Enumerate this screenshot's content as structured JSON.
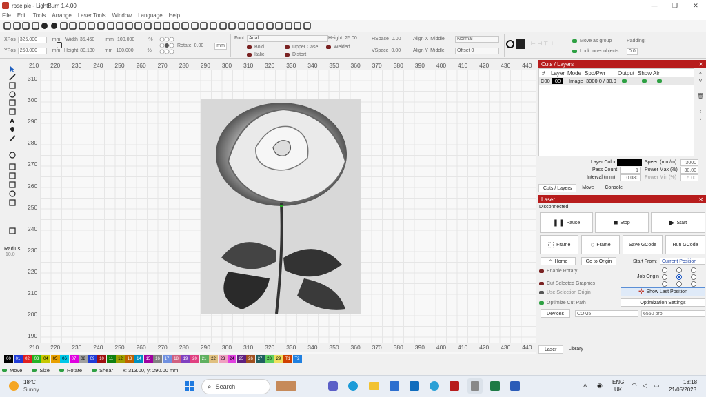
{
  "window": {
    "title": "rose pic - LightBurn 1.4.00",
    "minimize": "—",
    "restore": "❐",
    "close": "✕"
  },
  "menu": [
    "File",
    "Edit",
    "Tools",
    "Arrange",
    "Laser Tools",
    "Window",
    "Language",
    "Help"
  ],
  "toolbar_icons": [
    "new-icon",
    "open-icon",
    "save-icon",
    "save-as-icon",
    "import-icon",
    "undo-icon",
    "redo-icon",
    "copy-icon",
    "cut-icon",
    "paste-icon",
    "delete-icon",
    "move-icon",
    "zoom-in-icon",
    "zoom-out-icon",
    "zoom-fit-icon",
    "zoom-page-icon",
    "frame-icon",
    "camera-icon",
    "monitor-icon",
    "settings-icon",
    "tools-icon",
    "user-icon",
    "user-2-icon",
    "variable-text-icon",
    "align-icon",
    "group-icon",
    "ungroup-icon",
    "circle-icon",
    "grid-icon",
    "distribute-icon",
    "weld-icon",
    "center-icon",
    "cross-icon"
  ],
  "position": {
    "xpos_label": "XPos",
    "xpos": "325.000",
    "ypos_label": "YPos",
    "ypos": "250.000",
    "unit": "mm",
    "width_label": "Width",
    "width": "35.460",
    "height_label": "Height",
    "height": "80.130",
    "scale_x": "100.000",
    "scale_y": "100.000",
    "pct": "%",
    "rotate_label": "Rotate",
    "rotate": "0.00",
    "rotate_unit": "mm"
  },
  "text_props": {
    "font_label": "Font",
    "font": "Arial",
    "height_label": "Height",
    "height": "25.00",
    "hspace_label": "HSpace",
    "hspace": "0.00",
    "vspace_label": "VSpace",
    "vspace": "0.00",
    "bold": "Bold",
    "italic": "Italic",
    "upper": "Upper Case",
    "distort": "Distort",
    "welded": "Welded",
    "alignx_label": "Align X",
    "alignx": "Middle",
    "aligny_label": "Align Y",
    "aligny": "Middle",
    "style": "Normal",
    "offset": "Offset 0"
  },
  "group_opts": {
    "move_group": "Move as group",
    "lock_inner": "Lock inner objects",
    "padding_label": "Padding:",
    "padding": "0.0"
  },
  "left_tools": [
    "select-icon",
    "edit-nodes-icon",
    "rectangle-icon",
    "ellipse-icon",
    "polygon-icon",
    "polyline-icon",
    "text-icon",
    "position-icon",
    "measure-icon",
    "offset-icon",
    "boolean-icon",
    "weld-icon",
    "grid-array-icon",
    "circular-array-icon",
    "rotate-icon",
    "corner-icon"
  ],
  "radius": {
    "label": "Radius:",
    "value": "10.0"
  },
  "ruler_x": [
    "210",
    "220",
    "230",
    "240",
    "250",
    "260",
    "270",
    "280",
    "290",
    "300",
    "310",
    "320",
    "330",
    "340",
    "350",
    "360",
    "370",
    "380",
    "390",
    "400",
    "410",
    "420",
    "430",
    "440"
  ],
  "ruler_y": [
    "310",
    "300",
    "290",
    "280",
    "270",
    "260",
    "250",
    "240",
    "230",
    "220",
    "210",
    "200",
    "190"
  ],
  "palette": [
    {
      "l": "00",
      "c": "#000000",
      "fg": "#ffffff"
    },
    {
      "l": "01",
      "c": "#1f3bd6",
      "fg": "#ffffff"
    },
    {
      "l": "02",
      "c": "#e02020",
      "fg": "#ffffff"
    },
    {
      "l": "03",
      "c": "#24b324",
      "fg": "#ffffff"
    },
    {
      "l": "04",
      "c": "#c8c800",
      "fg": "#000000"
    },
    {
      "l": "05",
      "c": "#e8a000",
      "fg": "#000000"
    },
    {
      "l": "06",
      "c": "#00c8e8",
      "fg": "#000000"
    },
    {
      "l": "07",
      "c": "#e000e0",
      "fg": "#ffffff"
    },
    {
      "l": "08",
      "c": "#a0a0a0",
      "fg": "#000000"
    },
    {
      "l": "09",
      "c": "#1f3bd6",
      "fg": "#ffffff"
    },
    {
      "l": "10",
      "c": "#a01010",
      "fg": "#ffffff"
    },
    {
      "l": "11",
      "c": "#108010",
      "fg": "#ffffff"
    },
    {
      "l": "12",
      "c": "#a0a000",
      "fg": "#000000"
    },
    {
      "l": "13",
      "c": "#c06000",
      "fg": "#ffffff"
    },
    {
      "l": "14",
      "c": "#0090c0",
      "fg": "#ffffff"
    },
    {
      "l": "15",
      "c": "#a000a0",
      "fg": "#ffffff"
    },
    {
      "l": "16",
      "c": "#808080",
      "fg": "#ffffff"
    },
    {
      "l": "17",
      "c": "#7090e0",
      "fg": "#ffffff"
    },
    {
      "l": "18",
      "c": "#d06080",
      "fg": "#ffffff"
    },
    {
      "l": "19",
      "c": "#8040c0",
      "fg": "#ffffff"
    },
    {
      "l": "20",
      "c": "#e04080",
      "fg": "#ffffff"
    },
    {
      "l": "21",
      "c": "#60b060",
      "fg": "#ffffff"
    },
    {
      "l": "22",
      "c": "#e0c080",
      "fg": "#000000"
    },
    {
      "l": "23",
      "c": "#f0a0c0",
      "fg": "#000000"
    },
    {
      "l": "24",
      "c": "#e040e0",
      "fg": "#000000"
    },
    {
      "l": "25",
      "c": "#602080",
      "fg": "#ffffff"
    },
    {
      "l": "26",
      "c": "#a05020",
      "fg": "#ffffff"
    },
    {
      "l": "27",
      "c": "#206060",
      "fg": "#ffffff"
    },
    {
      "l": "28",
      "c": "#60d060",
      "fg": "#000000"
    },
    {
      "l": "29",
      "c": "#f0e060",
      "fg": "#000000"
    },
    {
      "l": "T1",
      "c": "#d04000",
      "fg": "#ffffff"
    },
    {
      "l": "T2",
      "c": "#2080e0",
      "fg": "#ffffff"
    }
  ],
  "status": {
    "move": "Move",
    "size": "Size",
    "rotate": "Rotate",
    "shear": "Shear",
    "coords": "x: 313.00, y: 290.00 mm"
  },
  "cuts": {
    "title": "Cuts / Layers",
    "headers": [
      "#",
      "Layer",
      "Mode",
      "Spd/Pwr",
      "Output",
      "Show",
      "Air"
    ],
    "row": {
      "num": "C00",
      "layer": "00",
      "mode": "Image",
      "spdpwr": "3000.0 / 30.0"
    },
    "layer_color_label": "Layer Color",
    "pass_label": "Pass Count",
    "pass": "1",
    "interval_label": "Interval (mm)",
    "interval": "0.080",
    "speed_label": "Speed (mm/m)",
    "speed": "3000",
    "pmax_label": "Power Max (%)",
    "pmax": "30.00",
    "pmin_label": "Power Min (%)",
    "pmin": "5.00",
    "tabs": [
      "Cuts / Layers",
      "Move",
      "Console"
    ]
  },
  "laser": {
    "title": "Laser",
    "status": "Disconnected",
    "pause": "Pause",
    "stop": "Stop",
    "start": "Start",
    "frame1": "Frame",
    "frame2": "Frame",
    "save_gcode": "Save GCode",
    "run_gcode": "Run GCode",
    "home": "Home",
    "goto_origin": "Go to Origin",
    "start_from_label": "Start From:",
    "start_from": "Current Position",
    "enable_rotary": "Enable Rotary",
    "job_origin": "Job Origin",
    "cut_selected": "Cut Selected Graphics",
    "use_sel_origin": "Use Selection Origin",
    "show_last": "Show Last Position",
    "optimize_cut": "Optimize Cut Path",
    "optimization_settings": "Optimization Settings",
    "devices": "Devices",
    "port": "COM5",
    "device": "6550 pro",
    "tabs": [
      "Laser",
      "Library"
    ]
  },
  "taskbar": {
    "temp": "18°C",
    "weather": "Sunny",
    "search": "Search",
    "lang1": "ENG",
    "lang2": "UK",
    "time": "18:18",
    "date": "21/05/2023"
  }
}
